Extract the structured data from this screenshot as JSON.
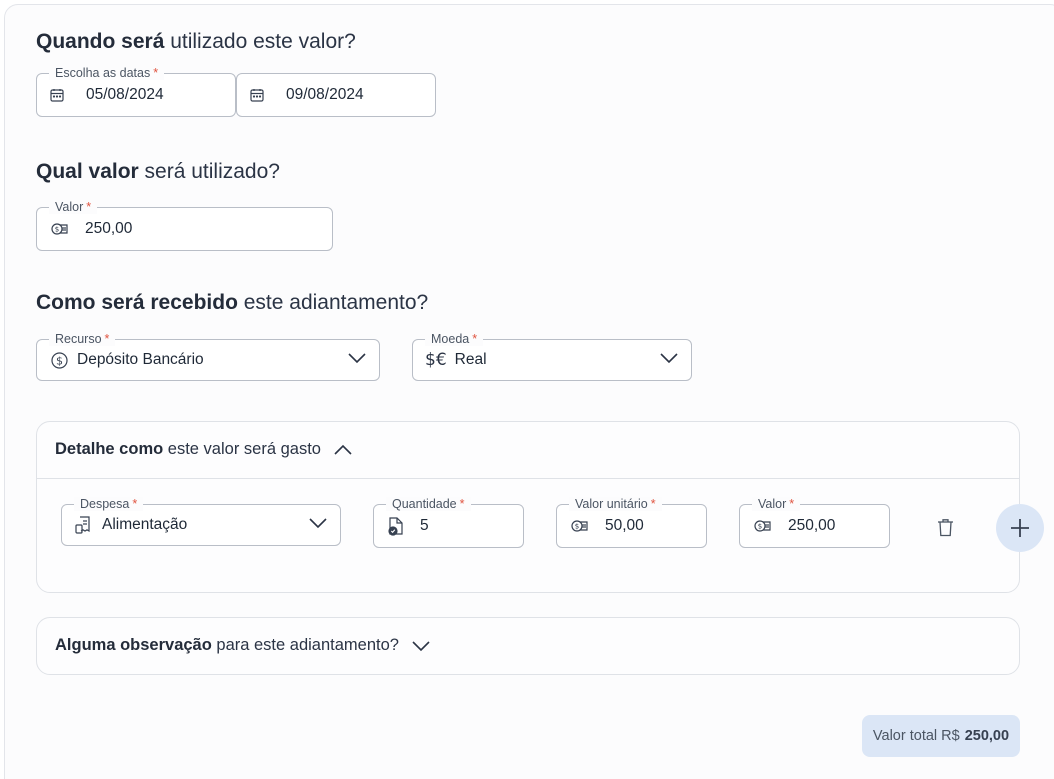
{
  "section_dates": {
    "title_bold": "Quando será",
    "title_rest": " utilizado este valor?"
  },
  "dates_field": {
    "label": "Escolha as datas",
    "required_mark": "*",
    "start": "05/08/2024",
    "end": "09/08/2024",
    "icon": "calendar-icon"
  },
  "section_value": {
    "title_bold": "Qual valor",
    "title_rest": " será utilizado?"
  },
  "value_field": {
    "label": "Valor",
    "required_mark": "*",
    "value": "250,00",
    "icon": "money-icon"
  },
  "section_receive": {
    "title_bold": "Como será recebido",
    "title_rest": " este adiantamento?"
  },
  "resource_field": {
    "label": "Recurso",
    "required_mark": "*",
    "value": "Depósito Bancário",
    "icon": "dollar-circle-icon"
  },
  "currency_field": {
    "label": "Moeda",
    "required_mark": "*",
    "value": "Real",
    "icon": "currency-exchange-icon"
  },
  "details_card": {
    "title_bold": "Detalhe como",
    "title_rest": " este valor será gasto",
    "expanded": true,
    "row": {
      "expense": {
        "label": "Despesa",
        "required_mark": "*",
        "value": "Alimentação"
      },
      "quantity": {
        "label": "Quantidade",
        "required_mark": "*",
        "value": "5"
      },
      "unit_value": {
        "label": "Valor unitário",
        "required_mark": "*",
        "value": "50,00"
      },
      "value": {
        "label": "Valor",
        "required_mark": "*",
        "value": "250,00"
      }
    }
  },
  "notes_card": {
    "title_bold": "Alguma observação",
    "title_rest": " para este adiantamento?",
    "expanded": false
  },
  "total": {
    "label": "Valor total R$",
    "value": "250,00"
  },
  "colors": {
    "accent_bg": "#dbe6f6",
    "required": "#e0533f",
    "border": "#b9bec7"
  }
}
